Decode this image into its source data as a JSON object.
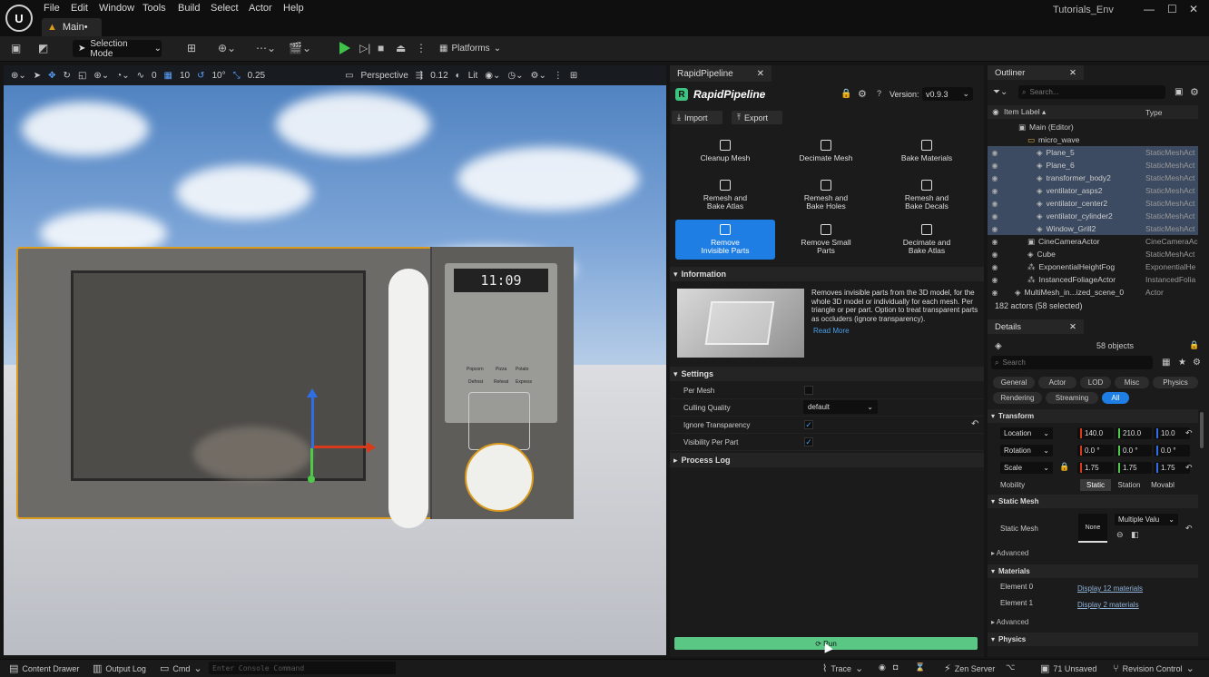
{
  "app": {
    "logo": "U",
    "project": "Tutorials_Env",
    "tab": "Main•"
  },
  "menu": [
    "File",
    "Edit",
    "Window",
    "Tools",
    "Build",
    "Select",
    "Actor",
    "Help"
  ],
  "toolbar": {
    "selection_mode": "Selection Mode",
    "platforms": "Platforms"
  },
  "viewport": {
    "toolbar": {
      "rotation_snap": "0",
      "grid_snap": "10",
      "angle_snap": "10°",
      "scale_snap": "0.25",
      "view": "Perspective",
      "camera_speed": "0.12",
      "lighting": "Lit"
    },
    "clock": "11:09",
    "keypad_labels": [
      "Popcorn",
      "Pizza",
      "Potato",
      "Defrost",
      "Reheat",
      "Express"
    ]
  },
  "rapidpipeline": {
    "tab": "RapidPipeline",
    "logo": "RapidPipeline",
    "version_label": "Version:",
    "version": "v0.9.3",
    "import": "Import",
    "export": "Export",
    "tools": [
      {
        "label": "Cleanup Mesh"
      },
      {
        "label": "Decimate Mesh"
      },
      {
        "label": "Bake Materials"
      },
      {
        "label": "Remesh and Bake Atlas"
      },
      {
        "label": "Remesh and Bake Holes"
      },
      {
        "label": "Remesh and Bake Decals"
      },
      {
        "label": "Remove Invisible Parts"
      },
      {
        "label": "Remove Small Parts"
      },
      {
        "label": "Decimate and Bake Atlas"
      }
    ],
    "information": {
      "title": "Information",
      "text": "Removes invisible parts from the 3D model, for the whole 3D model or individually for each mesh. Per triangle or per part. Option to treat transparent parts as occluders (ignore transparency).",
      "read_more": "Read More"
    },
    "settings": {
      "title": "Settings",
      "per_mesh": "Per Mesh",
      "culling_quality": "Culling Quality",
      "culling_value": "default",
      "ignore_transparency": "Ignore Transparency",
      "visibility_per_part": "Visibility Per Part",
      "checks": {
        "per_mesh": "",
        "ignore_transparency": "✓",
        "visibility_per_part": "✓"
      }
    },
    "process_log": "Process Log",
    "run": "Run"
  },
  "outliner": {
    "tab": "Outliner",
    "search_placeholder": "Search...",
    "col_label": "Item Label ▴",
    "col_type": "Type",
    "rows": [
      {
        "name": "Main (Editor)",
        "type": ""
      },
      {
        "name": "micro_wave",
        "type": ""
      },
      {
        "name": "Plane_5",
        "type": "StaticMeshAct"
      },
      {
        "name": "Plane_6",
        "type": "StaticMeshAct"
      },
      {
        "name": "transformer_body2",
        "type": "StaticMeshAct"
      },
      {
        "name": "ventilator_asps2",
        "type": "StaticMeshAct"
      },
      {
        "name": "ventilator_center2",
        "type": "StaticMeshAct"
      },
      {
        "name": "ventilator_cylinder2",
        "type": "StaticMeshAct"
      },
      {
        "name": "Window_Grill2",
        "type": "StaticMeshAct"
      },
      {
        "name": "CineCameraActor",
        "type": "CineCameraAc"
      },
      {
        "name": "Cube",
        "type": "StaticMeshAct"
      },
      {
        "name": "ExponentialHeightFog",
        "type": "ExponentialHe"
      },
      {
        "name": "InstancedFoliageActor",
        "type": "InstancedFolia"
      },
      {
        "name": "MultiMesh_in...ized_scene_0",
        "type": "Actor"
      }
    ],
    "footer": "182 actors (58 selected)"
  },
  "details": {
    "tab": "Details",
    "objects": "58 objects",
    "search_placeholder": "Search",
    "filters": [
      "General",
      "Actor",
      "LOD",
      "Misc",
      "Physics",
      "Rendering",
      "Streaming",
      "All"
    ],
    "transform": "Transform",
    "location": {
      "label": "Location",
      "x": "140.0",
      "y": "210.0",
      "z": "10.0"
    },
    "rotation": {
      "label": "Rotation",
      "x": "0.0 °",
      "y": "0.0 °",
      "z": "0.0 °"
    },
    "scale": {
      "label": "Scale",
      "x": "1.75",
      "y": "1.75",
      "z": "1.75"
    },
    "mobility": {
      "label": "Mobility",
      "options": [
        "Static",
        "Station",
        "Movabl"
      ]
    },
    "static_mesh_section": "Static Mesh",
    "static_mesh_label": "Static Mesh",
    "mesh_thumb": "None",
    "mesh_value": "Multiple Valu",
    "advanced": "Advanced",
    "materials": "Materials",
    "element0": "Element 0",
    "element0_value": "Display 12 materials",
    "element1": "Element 1",
    "element1_value": "Display 2 materials",
    "physics": "Physics"
  },
  "statusbar": {
    "content_drawer": "Content Drawer",
    "output_log": "Output Log",
    "cmd": "Cmd",
    "console_placeholder": "Enter Console Command",
    "trace": "Trace",
    "zen": "Zen Server",
    "unsaved": "71 Unsaved",
    "revision": "Revision Control"
  },
  "colors": {
    "accent": "#1f7ee3",
    "run": "#5bc785",
    "selection": "#d99a1d"
  }
}
